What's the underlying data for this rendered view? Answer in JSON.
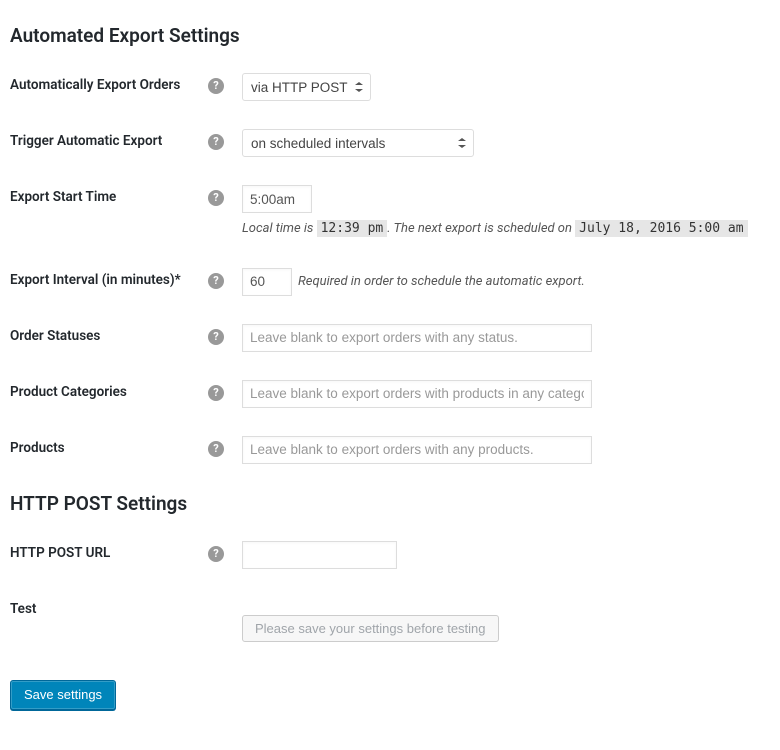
{
  "section1": {
    "title": "Automated Export Settings"
  },
  "auto_export": {
    "label": "Automatically Export Orders",
    "value": "via HTTP POST"
  },
  "trigger": {
    "label": "Trigger Automatic Export",
    "value": "on scheduled intervals"
  },
  "start_time": {
    "label": "Export Start Time",
    "value": "5:00am",
    "hint_prefix": "Local time is ",
    "local_time": "12:39 pm",
    "hint_mid": ". The next export is scheduled on ",
    "next_export": "July 18, 2016 5:00 am"
  },
  "interval": {
    "label": "Export Interval (in minutes)*",
    "value": "60",
    "hint": "Required in order to schedule the automatic export."
  },
  "statuses": {
    "label": "Order Statuses",
    "placeholder": "Leave blank to export orders with any status."
  },
  "categories": {
    "label": "Product Categories",
    "placeholder": "Leave blank to export orders with products in any category."
  },
  "products": {
    "label": "Products",
    "placeholder": "Leave blank to export orders with any products."
  },
  "section2": {
    "title": "HTTP POST Settings"
  },
  "url": {
    "label": "HTTP POST URL",
    "value": ""
  },
  "test": {
    "label": "Test",
    "button": "Please save your settings before testing"
  },
  "save": {
    "label": "Save settings"
  },
  "help_icon_glyph": "?"
}
